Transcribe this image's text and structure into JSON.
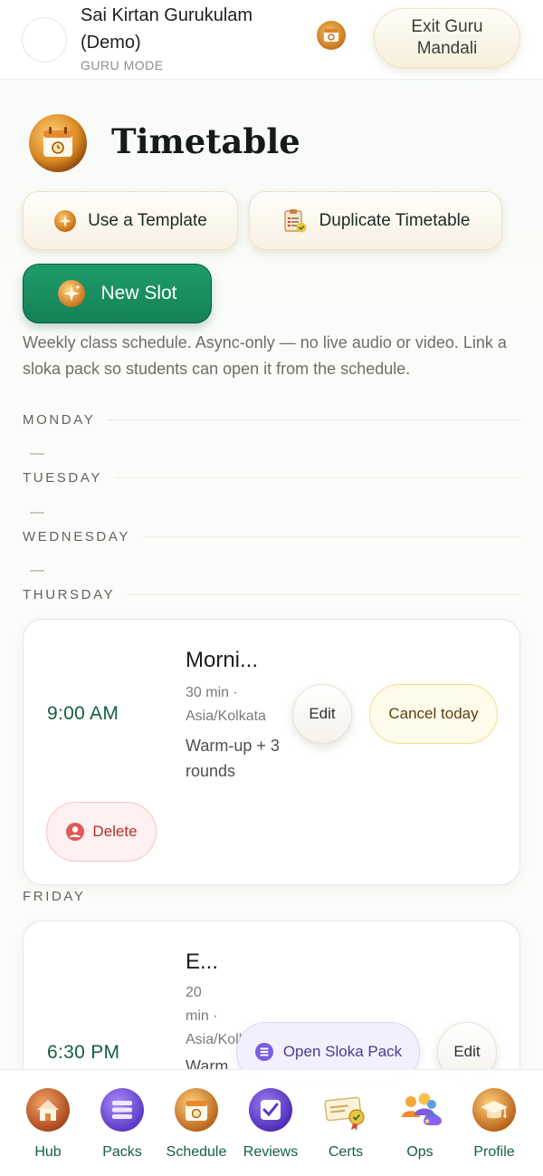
{
  "header": {
    "org_name": "Sai Kirtan Gurukulam (Demo)",
    "mode": "GURU MODE",
    "exit_label": "Exit Guru Mandali"
  },
  "page": {
    "title": "Timetable",
    "description": "Weekly class schedule. Async-only — no live audio or video. Link a sloka pack so students can open it from the schedule."
  },
  "actions": {
    "template_label": "Use a Template",
    "duplicate_label": "Duplicate Timetable",
    "new_slot_label": "New Slot"
  },
  "days": {
    "monday": "MONDAY",
    "tuesday": "TUESDAY",
    "wednesday": "WEDNESDAY",
    "thursday": "THURSDAY",
    "friday": "FRIDAY",
    "empty_marker": "—"
  },
  "slots": {
    "thursday": {
      "time": "9:00 AM",
      "title": "Morni...",
      "duration": "30 min ·",
      "timezone": "Asia/Kolkata",
      "notes": "Warm-up + 3 rounds",
      "edit_label": "Edit",
      "cancel_label": "Cancel today",
      "delete_label": "Delete"
    },
    "friday": {
      "time": "6:30 PM",
      "title": "E...",
      "duration_num": "20",
      "duration_unit": "min ·",
      "timezone": "Asia/Kolkata",
      "notes": "Warm",
      "sloka_label": "Open Sloka Pack",
      "edit_label": "Edit"
    }
  },
  "nav": {
    "items": [
      {
        "label": "Hub",
        "icon": "house-icon"
      },
      {
        "label": "Packs",
        "icon": "stack-icon"
      },
      {
        "label": "Schedule",
        "icon": "calendar-icon"
      },
      {
        "label": "Reviews",
        "icon": "check-icon"
      },
      {
        "label": "Certs",
        "icon": "certificate-icon"
      },
      {
        "label": "Ops",
        "icon": "people-icon"
      },
      {
        "label": "Profile",
        "icon": "graduation-cap-icon"
      }
    ]
  },
  "colors": {
    "brand_green": "#148255",
    "time_green": "#14603d",
    "delete_red": "#b32e2e",
    "sloka_purple": "#4b3c92"
  }
}
